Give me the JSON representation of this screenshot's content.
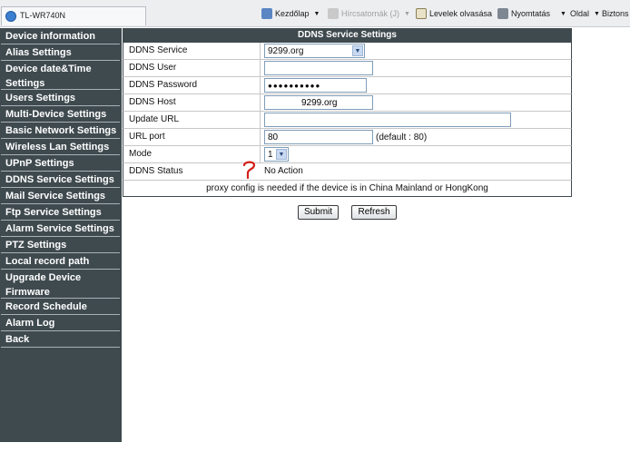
{
  "browser": {
    "tab_title": "TL-WR740N",
    "toolbar": {
      "home_label": "Kezdőlap",
      "feeds_label": "Hírcsatornák (J)",
      "mail_label": "Levelek olvasása",
      "print_label": "Nyomtatás",
      "page_label": "Oldal",
      "safety_label": "Biztons"
    },
    "colors": {
      "toolbar_bg": "#edeef0"
    }
  },
  "sidebar": {
    "colors": {
      "bg": "#3f4a4f",
      "text": "#ffffff"
    },
    "items": [
      {
        "label": "Device information"
      },
      {
        "label": "Alias Settings"
      },
      {
        "label": "Device date&Time Settings"
      },
      {
        "label": "Users Settings"
      },
      {
        "label": "Multi-Device Settings"
      },
      {
        "label": "Basic Network Settings"
      },
      {
        "label": "Wireless Lan Settings"
      },
      {
        "label": "UPnP Settings"
      },
      {
        "label": "DDNS Service Settings"
      },
      {
        "label": "Mail Service Settings"
      },
      {
        "label": "Ftp Service Settings"
      },
      {
        "label": "Alarm Service Settings"
      },
      {
        "label": "PTZ Settings"
      },
      {
        "label": "Local record path"
      },
      {
        "label": "Upgrade Device Firmware"
      },
      {
        "label": "Record Schedule"
      },
      {
        "label": "Alarm Log"
      },
      {
        "label": "Back"
      }
    ]
  },
  "ddns": {
    "title": "DDNS Service Settings",
    "service": {
      "label": "DDNS Service",
      "value": "9299.org"
    },
    "user": {
      "label": "DDNS User",
      "value": ""
    },
    "password": {
      "label": "DDNS Password",
      "value": "●●●●●●●●●●"
    },
    "host": {
      "label": "DDNS Host",
      "value": "9299.org"
    },
    "update_url": {
      "label": "Update URL",
      "value": ""
    },
    "url_port": {
      "label": "URL port",
      "value": "80",
      "hint": "(default : 80)"
    },
    "mode": {
      "label": "Mode",
      "value": "1"
    },
    "status": {
      "label": "DDNS Status",
      "value": "No Action"
    },
    "proxy_note": "proxy config is needed if the device is in China Mainland or HongKong"
  },
  "buttons": {
    "submit": "Submit",
    "refresh": "Refresh"
  }
}
